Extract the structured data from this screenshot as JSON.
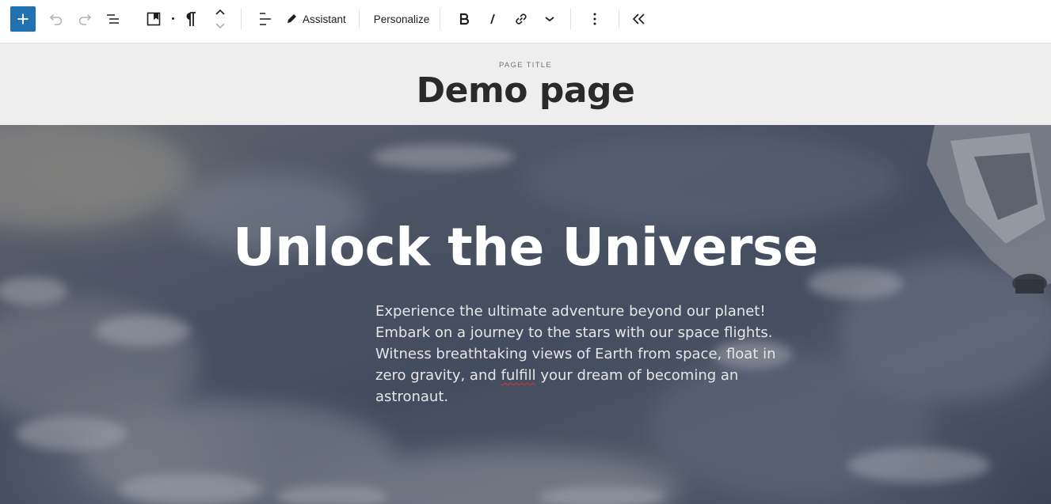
{
  "toolbar": {
    "add_label": "+",
    "assistant_label": "Assistant",
    "personalize_label": "Personalize"
  },
  "icons": {
    "add": "plus-icon",
    "undo": "undo-icon",
    "redo": "redo-icon",
    "list_view": "list-view-icon",
    "block_type": "bookmark-icon",
    "paragraph": "paragraph-icon",
    "move": "move-up-down-icon",
    "align": "align-left-icon",
    "assistant": "pencil-icon",
    "bold": "bold-icon",
    "italic": "italic-icon",
    "link": "link-icon",
    "more_formatting": "chevron-down-icon",
    "options": "more-vertical-icon",
    "collapse": "chevrons-left-icon"
  },
  "title_area": {
    "label": "PAGE TITLE",
    "title": "Demo page"
  },
  "hero": {
    "heading": "Unlock the Universe",
    "paragraph_before": "Experience the ultimate adventure beyond our planet! Embark on a journey to the stars with our space flights. Witness breathtaking views of Earth from space, float in zero gravity, and ",
    "misspelled_word": "fulfill",
    "paragraph_after": " your dream of becoming an astronaut."
  },
  "colors": {
    "accent": "#2271b1",
    "title_bg": "#eeeeee",
    "spellcheck": "#d63638"
  }
}
